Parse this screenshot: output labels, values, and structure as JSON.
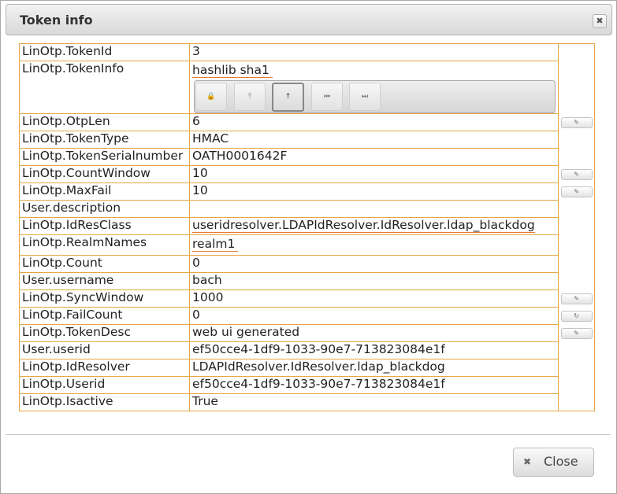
{
  "dialog": {
    "title": "Token info",
    "close_icon": "✖",
    "footer_close_label": "Close",
    "footer_close_icon": "✖"
  },
  "rows": [
    {
      "key": "LinOtp.TokenId",
      "value": "3"
    },
    {
      "key": "LinOtp.TokenInfo",
      "value": "hashlib sha1"
    },
    {
      "key": "LinOtp.OtpLen",
      "value": "6"
    },
    {
      "key": "LinOtp.TokenType",
      "value": "HMAC"
    },
    {
      "key": "LinOtp.TokenSerialnumber",
      "value": "OATH0001642F"
    },
    {
      "key": "LinOtp.CountWindow",
      "value": "10"
    },
    {
      "key": "LinOtp.MaxFail",
      "value": "10"
    },
    {
      "key": "User.description",
      "value": ""
    },
    {
      "key": "LinOtp.IdResClass",
      "value": "useridresolver.LDAPIdResolver.IdResolver.ldap_blackdog"
    },
    {
      "key": "LinOtp.RealmNames",
      "value": "realm1"
    },
    {
      "key": "LinOtp.Count",
      "value": "0"
    },
    {
      "key": "User.username",
      "value": "bach"
    },
    {
      "key": "LinOtp.SyncWindow",
      "value": "1000"
    },
    {
      "key": "LinOtp.FailCount",
      "value": "0"
    },
    {
      "key": "LinOtp.TokenDesc",
      "value": "web ui generated"
    },
    {
      "key": "User.userid",
      "value": "ef50cce4-1df9-1033-90e7-713823084e1f"
    },
    {
      "key": "LinOtp.IdResolver",
      "value": "LDAPIdResolver.IdResolver.ldap_blackdog"
    },
    {
      "key": "LinOtp.Userid",
      "value": "ef50cce4-1df9-1033-90e7-713823084e1f"
    },
    {
      "key": "LinOtp.Isactive",
      "value": "True"
    }
  ],
  "icons": {
    "edit": "✎",
    "reset": "↻",
    "tb_lock": "🔒",
    "tb_top": "⤒",
    "tb_up": "↑",
    "tb_first": "⏮",
    "tb_last": "⏭"
  }
}
